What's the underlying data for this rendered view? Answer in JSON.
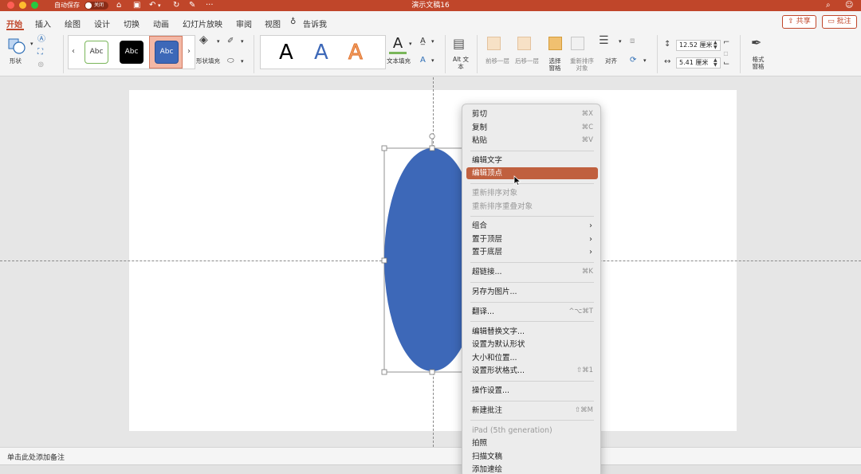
{
  "titlebar": {
    "autosave_label": "自动保存",
    "autosave_toggle": "关闭",
    "title": "演示文稿16",
    "more_icon": "···",
    "icons": [
      "home-icon",
      "save-icon",
      "undo-icon",
      "redo-icon",
      "edit-icon"
    ]
  },
  "tabs": [
    "开始",
    "插入",
    "绘图",
    "设计",
    "切换",
    "动画",
    "幻灯片放映",
    "审阅",
    "视图"
  ],
  "tell_me": "告诉我",
  "share_label": "共享",
  "comment_label": "批注",
  "ribbon": {
    "shape_label": "形状",
    "shape_fill_label": "形状填充",
    "style_samples": [
      "Abc",
      "Abc",
      "Abc"
    ],
    "wordart_samples": [
      "A",
      "A",
      "A"
    ],
    "text_fill_label": "文本填充",
    "alt_text_label": "Alt 文本",
    "bring_forward_label": "前移一层",
    "send_backward_label": "后移一层",
    "selection_pane_label": "选择 窗格",
    "reorder_label": "重新排序对象",
    "align_label": "对齐",
    "height_value": "12.52 厘米",
    "width_value": "5.41 厘米",
    "format_pane_label": "格式 窗格"
  },
  "notes_placeholder": "单击此处添加备注",
  "context_menu": {
    "groups": [
      [
        {
          "label": "剪切",
          "shortcut": "⌘X",
          "disabled": false
        },
        {
          "label": "复制",
          "shortcut": "⌘C",
          "disabled": false
        },
        {
          "label": "粘贴",
          "shortcut": "⌘V",
          "disabled": false
        }
      ],
      [
        {
          "label": "编辑文字",
          "shortcut": "",
          "disabled": false
        },
        {
          "label": "编辑顶点",
          "shortcut": "",
          "disabled": false,
          "highlighted": true
        }
      ],
      [
        {
          "label": "重新排序对象",
          "shortcut": "",
          "disabled": true
        },
        {
          "label": "重新排序重叠对象",
          "shortcut": "",
          "disabled": true
        }
      ],
      [
        {
          "label": "组合",
          "submenu": true
        },
        {
          "label": "置于顶层",
          "submenu": true
        },
        {
          "label": "置于底层",
          "submenu": true
        }
      ],
      [
        {
          "label": "超链接...",
          "shortcut": "⌘K",
          "disabled": false
        }
      ],
      [
        {
          "label": "另存为图片...",
          "shortcut": "",
          "disabled": false
        }
      ],
      [
        {
          "label": "翻译...",
          "shortcut": "^⌥⌘T",
          "disabled": false
        }
      ],
      [
        {
          "label": "编辑替换文字...",
          "shortcut": "",
          "disabled": false
        },
        {
          "label": "设置为默认形状",
          "shortcut": "",
          "disabled": false
        },
        {
          "label": "大小和位置...",
          "shortcut": "",
          "disabled": false
        },
        {
          "label": "设置形状格式...",
          "shortcut": "⇧⌘1",
          "disabled": false
        }
      ],
      [
        {
          "label": "操作设置...",
          "shortcut": "",
          "disabled": false
        }
      ],
      [
        {
          "label": "新建批注",
          "shortcut": "⇧⌘M",
          "disabled": false
        }
      ],
      [
        {
          "label": "iPad (5th generation)",
          "shortcut": "",
          "disabled": true
        },
        {
          "label": "拍照",
          "shortcut": "",
          "disabled": false
        },
        {
          "label": "扫描文稿",
          "shortcut": "",
          "disabled": false
        },
        {
          "label": "添加速绘",
          "shortcut": "",
          "disabled": false
        }
      ]
    ]
  },
  "colors": {
    "accent": "#c0462a",
    "shape_fill": "#3d68b8",
    "menu_highlight": "#c0603f"
  }
}
